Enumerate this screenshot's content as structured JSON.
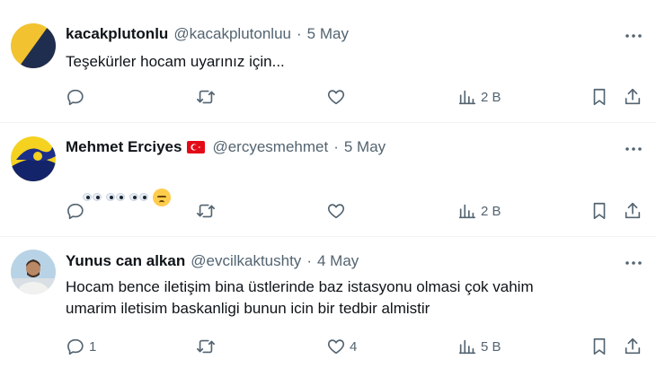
{
  "tweets": [
    {
      "name": "kacakplutonlu",
      "handle": "@kacakplutonluu",
      "separator": "·",
      "date": "5 May",
      "text": "Teşekürler hocam uyarınız için...",
      "has_flag": false,
      "actions": {
        "reply": "",
        "retweet": "",
        "like": "",
        "views": "2 B"
      }
    },
    {
      "name": "Mehmet Erciyes",
      "handle": "@ercyesmehmet",
      "separator": "·",
      "date": "5 May",
      "text": "",
      "emoji_text": "👀👀👀😔",
      "has_flag": true,
      "flag_icon": "turkey-flag-icon",
      "actions": {
        "reply": "",
        "retweet": "",
        "like": "",
        "views": "2 B"
      }
    },
    {
      "name": "Yunus can alkan",
      "handle": "@evcilkaktushty",
      "separator": "·",
      "date": "4 May",
      "text": "Hocam bence iletişim bina üstlerinde baz istasyonu olmasi çok vahim\numarim iletisim baskanligi bunun icin bir tedbir almistir",
      "has_flag": false,
      "actions": {
        "reply": "1",
        "retweet": "",
        "like": "4",
        "views": "5 B"
      }
    }
  ],
  "colors": {
    "text": "#0f1419",
    "secondary": "#536471",
    "divider": "#eff3f4",
    "flag_red": "#e30a17"
  }
}
